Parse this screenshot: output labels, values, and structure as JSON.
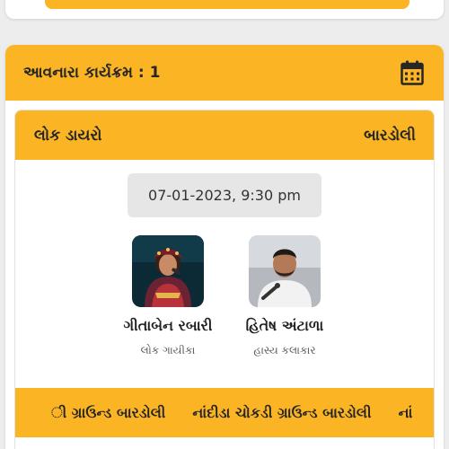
{
  "colors": {
    "accent": "#fbb424",
    "background": "#ededed",
    "card": "#ffffff",
    "date_badge": "#e6e6e6",
    "text_dark": "#262626"
  },
  "upcoming": {
    "title": "આવનારા કાર્યક્રમ : 1",
    "icon": "calendar-icon"
  },
  "event": {
    "name": "લોક ડાયરો",
    "city": "બારડોલી",
    "datetime": "07-01-2023, 9:30 pm",
    "artists": [
      {
        "name": "ગીતાબેન રબારી",
        "role": "લોક ગાયીકા",
        "photo": "artist-photo-geetaben"
      },
      {
        "name": "હિતેષ અંટાળા",
        "role": "હાસ્ય કલાકાર",
        "photo": "artist-photo-hitesh"
      }
    ],
    "venue_marquee": [
      "ી ગ્રાઉન્ડ બારડોલી",
      "નાંદીડા ચોકડી ગ્રાઉન્ડ બારડોલી",
      "નાં"
    ]
  }
}
